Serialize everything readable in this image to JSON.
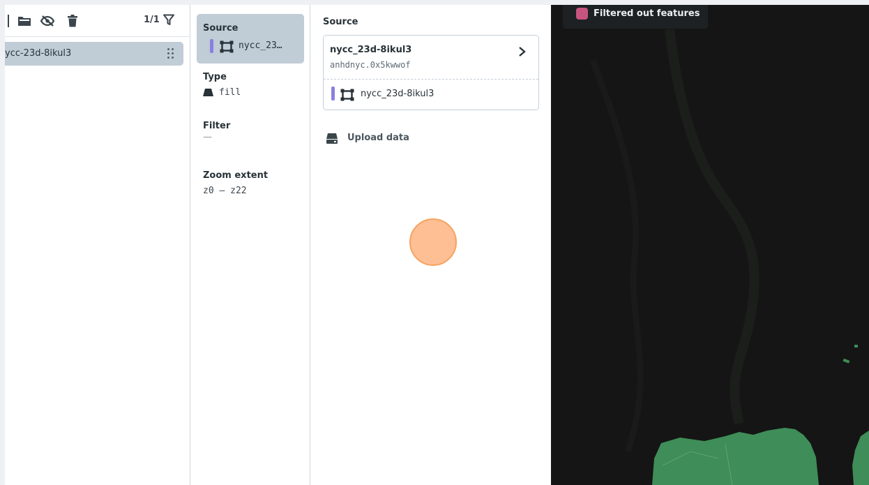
{
  "layers_panel": {
    "count": "1/1",
    "layer_name": "ycc-23d-8ikul3"
  },
  "tabs": {
    "source": {
      "title": "Source",
      "value": "nycc_23…"
    },
    "type": {
      "title": "Type",
      "value": "fill"
    },
    "filter": {
      "title": "Filter",
      "value": "—"
    },
    "zoom": {
      "title": "Zoom extent",
      "value": "z0 – z22"
    }
  },
  "source_detail": {
    "title": "Source",
    "card_name": "nycc_23d-8ikul3",
    "card_id": "anhdnyc.0x5kwwof",
    "card_layer": "nycc_23d-8ikul3",
    "upload_label": "Upload data"
  },
  "map": {
    "legend_label": "Filtered out features",
    "legend_color": "#c75480",
    "feature_color": "#3f8d58",
    "background_color": "#141514"
  },
  "colors": {
    "selected_bg": "#c0ccd6",
    "source_accent": "#8a80e0"
  }
}
